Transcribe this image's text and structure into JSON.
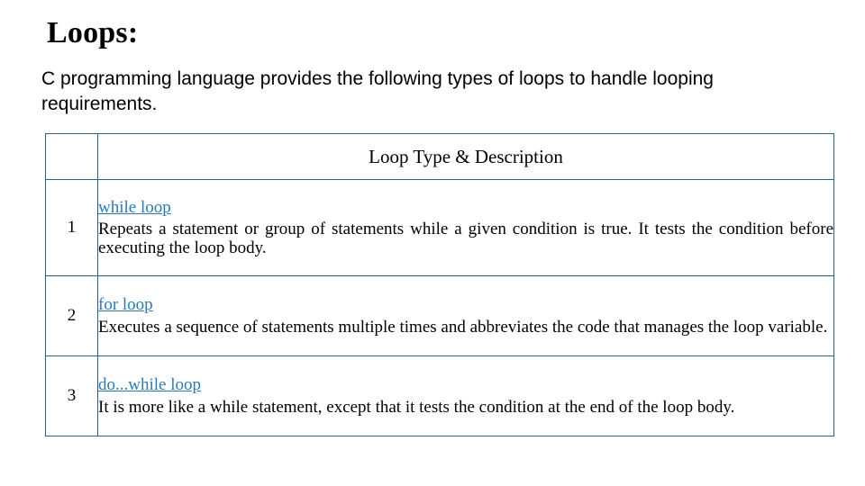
{
  "slide": {
    "title": "Loops:",
    "intro": "C programming language provides the following types of loops to handle looping requirements.",
    "table": {
      "header": {
        "blank": "",
        "description": "Loop Type & Description"
      },
      "rows": [
        {
          "num": "1",
          "link": "while loop",
          "text": "Repeats a statement or group of statements while a given condition is true. It tests the condition before executing the loop body."
        },
        {
          "num": "2",
          "link": "for loop",
          "text": "Executes a sequence of statements multiple times and abbreviates the code that manages the loop variable."
        },
        {
          "num": "3",
          "link": "do...while loop",
          "text": "It is more like a while statement, except that it tests the condition at the end of the loop body."
        }
      ]
    },
    "colors": {
      "border": "#2e5f8a",
      "link": "#2b7bb9",
      "text": "#000000"
    }
  }
}
